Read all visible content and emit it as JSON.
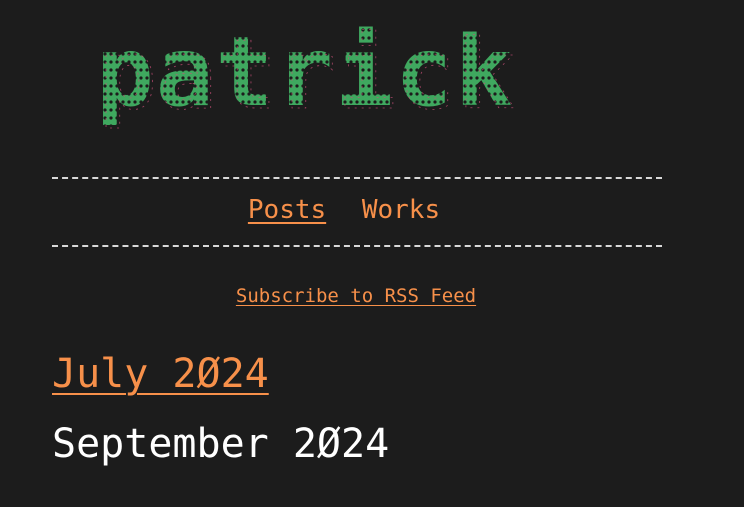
{
  "site": {
    "logo_text": "patrick"
  },
  "nav": {
    "items": [
      {
        "label": "Posts"
      },
      {
        "label": "Works"
      }
    ]
  },
  "rss": {
    "label": "Subscribe to RSS Feed"
  },
  "archive": {
    "linked_month": "July 2Ø24",
    "current_month": "September 2Ø24"
  },
  "colors": {
    "background": "#1c1c1c",
    "accent": "#f7904a",
    "text": "#ffffff",
    "logo_green": "#3fa85f",
    "logo_pink": "#c74f78"
  }
}
